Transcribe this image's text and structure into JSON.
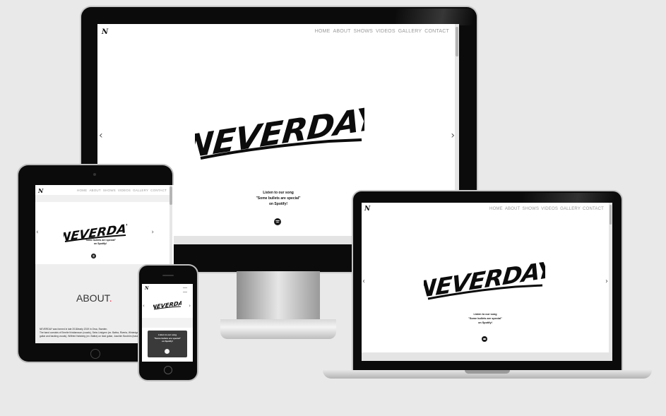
{
  "brand": {
    "logo_mark": "N",
    "wordmark": "NEVERDAY"
  },
  "nav": {
    "items": [
      "HOME",
      "ABOUT",
      "SHOWS",
      "VIDEOS",
      "GALLERY",
      "CONTACT"
    ]
  },
  "hero": {
    "line1": "Listen to our song",
    "line2": "\"Some bullets are special\"",
    "line3": "on Spotify!",
    "tablet_line2": "\"Some bullets are special\"",
    "tablet_line3": "on Spotify!",
    "spotify_icon": "spotify-icon"
  },
  "carousel": {
    "prev_glyph": "‹",
    "next_glyph": "›"
  },
  "about": {
    "heading": "ABOUT",
    "heading_dot": ".",
    "text_line1": "NEVERDAY was formed in late 2018/early 2019 in Orsa, Sweden.",
    "text_line2": "The band consists of Emelie Kristiansson (vocals), Sebs Lindgren (ex. Battra, Riveria, Wintedge).",
    "text_line3": "guitar and backing vocals), Wilfried Halsberg (ex. Battra) on lead guitar, Joachim Boström (bass)"
  },
  "phone_hero": {
    "line1": "Listen to our song",
    "line2": "\"Some bullets are special\"",
    "line3": "on Spotify!"
  },
  "colors": {
    "accent": "#e0334c",
    "background": "#e9e9e9",
    "bezel": "#0b0b0b"
  }
}
